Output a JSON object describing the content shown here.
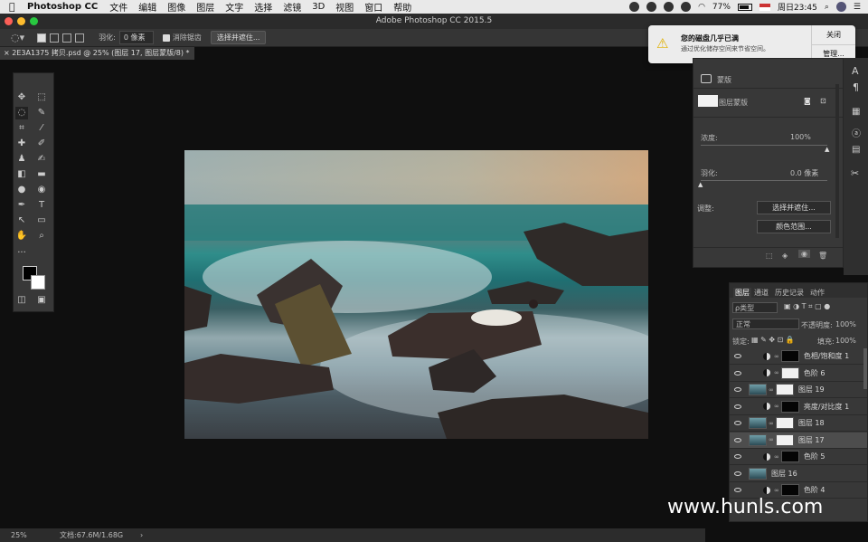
{
  "menubar": {
    "app_name": "Photoshop CC",
    "items": [
      "文件",
      "编辑",
      "图像",
      "图层",
      "文字",
      "选择",
      "滤镜",
      "3D",
      "视图",
      "窗口",
      "帮助"
    ],
    "battery": "77%",
    "clock": "周日23:45"
  },
  "window": {
    "title": "Adobe Photoshop CC 2015.5"
  },
  "options_bar": {
    "feather_label": "羽化:",
    "feather_value": "0 像素",
    "antialias_label": "消除锯齿",
    "select_mask_button": "选择并遮住..."
  },
  "document_tab": {
    "label": "2E3A1375 拷贝.psd @ 25% (图层 17, 图层蒙版/8) *"
  },
  "notification": {
    "title": "您的磁盘几乎已满",
    "body": "通过优化储存空间来节省空间。",
    "close_button": "关闭",
    "manage_button": "管理..."
  },
  "properties": {
    "mask_label": "蒙版",
    "layer_mask_label": "图层蒙版",
    "density_label": "浓度:",
    "density_value": "100%",
    "density_fraction": 1.0,
    "feather_label": "羽化:",
    "feather_value": "0.0 像素",
    "feather_fraction": 0.0,
    "adjust_label": "调整:",
    "select_and_mask_button": "选择并遮住...",
    "color_range_button": "颜色范围..."
  },
  "layers_panel": {
    "tabs": [
      "图层",
      "通道",
      "历史记录",
      "动作"
    ],
    "filter_label": "ρ类型",
    "blend_mode": "正常",
    "opacity_label": "不透明度:",
    "opacity_value": "100%",
    "lock_label": "锁定:",
    "fill_label": "填充:",
    "fill_value": "100%",
    "layers": [
      {
        "name": "色相/饱和度 1",
        "type": "adjustment",
        "mask": "black"
      },
      {
        "name": "色阶 6",
        "type": "adjustment",
        "mask": "white"
      },
      {
        "name": "图层 19",
        "type": "pixel",
        "mask": "white"
      },
      {
        "name": "亮度/对比度 1",
        "type": "adjustment",
        "mask": "black"
      },
      {
        "name": "图层 18",
        "type": "pixel",
        "mask": "white"
      },
      {
        "name": "图层 17",
        "type": "pixel",
        "mask": "white"
      },
      {
        "name": "色阶 5",
        "type": "adjustment",
        "mask": "black"
      },
      {
        "name": "图层 16",
        "type": "pixel",
        "mask": "none"
      },
      {
        "name": "色阶 4",
        "type": "adjustment",
        "mask": "black"
      }
    ]
  },
  "status_bar": {
    "zoom": "25%",
    "doc_info": "文档:67.6M/1.68G"
  },
  "watermark": "www.hunls.com"
}
